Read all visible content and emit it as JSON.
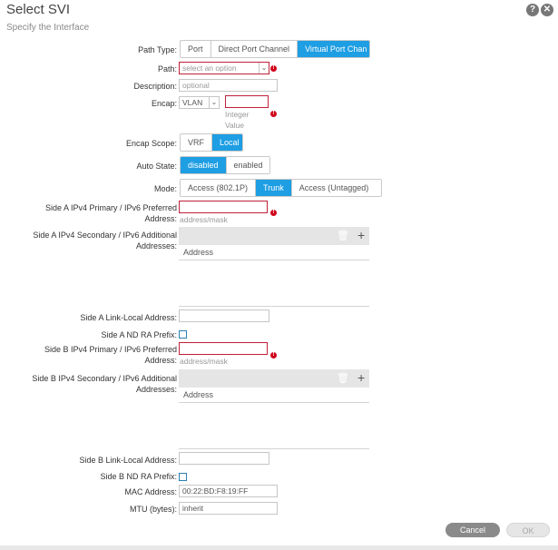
{
  "header": {
    "title": "Select SVI",
    "subtitle": "Specify the Interface",
    "help_glyph": "?",
    "close_glyph": "✕"
  },
  "path_type": {
    "label": "Path Type:",
    "options": [
      "Port",
      "Direct Port Channel",
      "Virtual Port Chan"
    ],
    "selected": "Virtual Port Chan"
  },
  "path": {
    "label": "Path:",
    "placeholder": "select an option"
  },
  "description": {
    "label": "Description:",
    "placeholder": "optional"
  },
  "encap": {
    "label": "Encap:",
    "type_value": "VLAN",
    "hint_line1": "Integer",
    "hint_line2": "Value"
  },
  "encap_scope": {
    "label": "Encap Scope:",
    "options": [
      "VRF",
      "Local"
    ],
    "selected": "Local"
  },
  "auto_state": {
    "label": "Auto State:",
    "options": [
      "disabled",
      "enabled"
    ],
    "selected": "disabled"
  },
  "mode": {
    "label": "Mode:",
    "options": [
      "Access (802.1P)",
      "Trunk",
      "Access (Untagged)"
    ],
    "selected": "Trunk"
  },
  "side_a_primary": {
    "label_line1": "Side A IPv4 Primary / IPv6 Preferred",
    "label_line2": "Address:",
    "hint": "address/mask"
  },
  "side_a_secondary": {
    "label_line1": "Side A IPv4 Secondary / IPv6 Additional",
    "label_line2": "Addresses:",
    "column": "Address"
  },
  "side_a_link_local": {
    "label": "Side A Link-Local Address:"
  },
  "side_a_nd_ra": {
    "label": "Side A ND RA Prefix:"
  },
  "side_b_primary": {
    "label_line1": "Side B IPv4 Primary / IPv6 Preferred",
    "label_line2": "Address:",
    "hint": "address/mask"
  },
  "side_b_secondary": {
    "label_line1": "Side B IPv4 Secondary / IPv6 Additional",
    "label_line2": "Addresses:",
    "column": "Address"
  },
  "side_b_link_local": {
    "label": "Side B Link-Local Address:"
  },
  "side_b_nd_ra": {
    "label": "Side B ND RA Prefix:"
  },
  "mac_address": {
    "label": "MAC Address:",
    "value": "00:22:BD:F8:19:FF"
  },
  "mtu": {
    "label": "MTU (bytes):",
    "value": "inherit"
  },
  "error_glyph": "!",
  "icons": {
    "delete": "trash-icon",
    "add": "plus-icon"
  },
  "actions": {
    "cancel": "Cancel",
    "ok": "OK"
  },
  "colors": {
    "accent": "#1e9ee3",
    "error": "#d0021b",
    "cancel_bg": "#8a8a8a"
  }
}
